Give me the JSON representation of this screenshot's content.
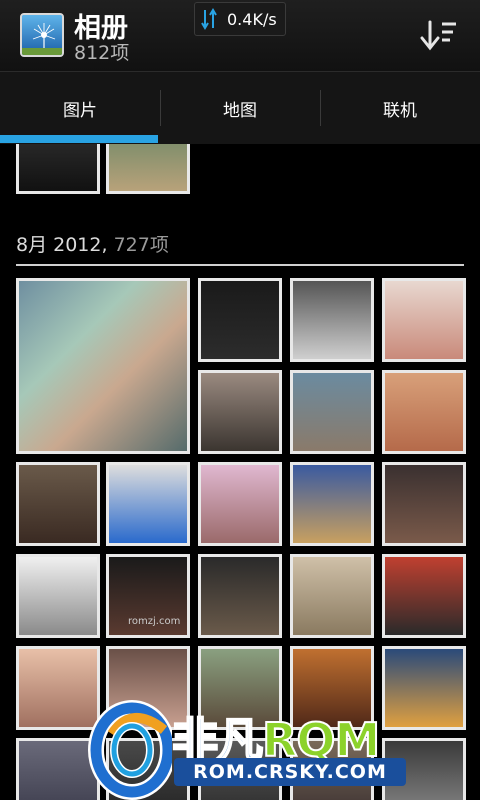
{
  "header": {
    "title": "相册",
    "count": "812项",
    "speed": "0.4K/s",
    "icons": {
      "app": "album-dandelion-icon",
      "speed": "data-transfer-arrows-icon",
      "sort": "sort-down-icon"
    }
  },
  "tabs": [
    {
      "label": "图片",
      "selected": true
    },
    {
      "label": "地图",
      "selected": false
    },
    {
      "label": "联机",
      "selected": false
    }
  ],
  "section": {
    "date": "8月 2012,",
    "count": "727项"
  },
  "watermark": {
    "text_fei": "非凡",
    "text_rom": "RQM",
    "url": "ROM.CRSKY.COM",
    "small": "romzj.com"
  },
  "colors": {
    "accent": "#29a3e3",
    "background": "#000000",
    "header_bg": "#1a1a1a"
  }
}
